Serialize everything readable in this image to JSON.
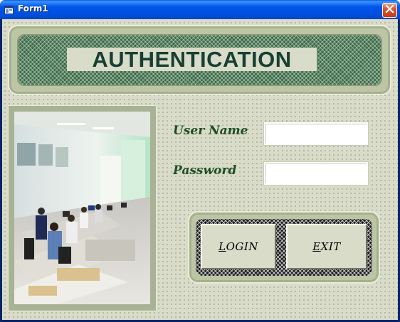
{
  "window": {
    "title": "Form1",
    "title_icon": "vb-form-icon",
    "close_icon": "close-icon"
  },
  "header": {
    "title": "AUTHENTICATION"
  },
  "photo": {
    "icon": "office-photo"
  },
  "form": {
    "username_label": "User Name",
    "username_value": "",
    "password_label": "Password",
    "password_value": ""
  },
  "buttons": {
    "login_access_key": "L",
    "login_rest": "OGIN",
    "exit_access_key": "E",
    "exit_rest": "XIT"
  },
  "colors": {
    "form_background": "#d9dcc8",
    "label_text": "#1e4f24",
    "header_text": "#173f34",
    "title_bar": "#0055ea"
  }
}
